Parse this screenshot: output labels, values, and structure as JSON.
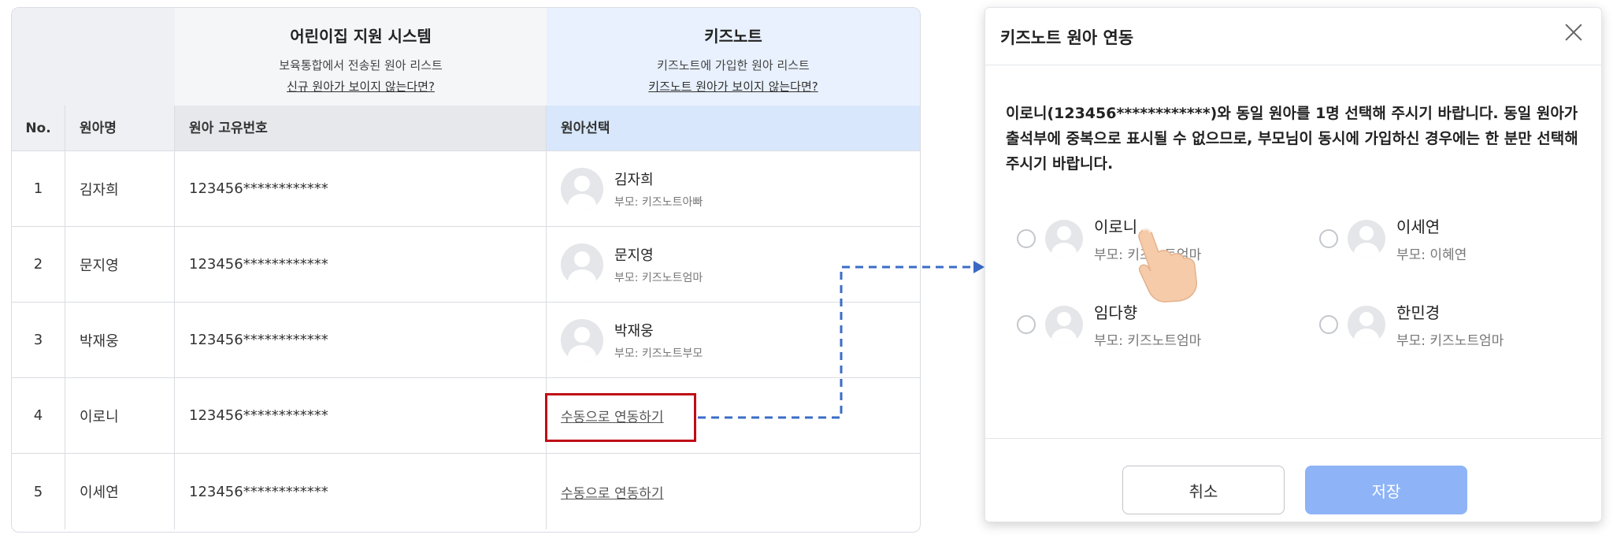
{
  "table": {
    "header_system": {
      "title": "어린이집 지원 시스템",
      "subtitle": "보육통합에서 전송된 원아 리스트",
      "link": "신규 원아가 보이지 않는다면?"
    },
    "header_kidsnote": {
      "title": "키즈노트",
      "subtitle": "키즈노트에 가입한 원아 리스트",
      "link": "키즈노트 원아가 보이지 않는다면?"
    },
    "columns": {
      "no": "No.",
      "name": "원아명",
      "id": "원아 고유번호",
      "select": "원아선택"
    },
    "rows": [
      {
        "no": "1",
        "name": "김자희",
        "id": "123456************",
        "kid_name": "김자희",
        "parent": "부모: 키즈노트아빠"
      },
      {
        "no": "2",
        "name": "문지영",
        "id": "123456************",
        "kid_name": "문지영",
        "parent": "부모: 키즈노트엄마"
      },
      {
        "no": "3",
        "name": "박재웅",
        "id": "123456************",
        "kid_name": "박재웅",
        "parent": "부모: 키즈노트부모"
      },
      {
        "no": "4",
        "name": "이로니",
        "id": "123456************",
        "link": "수동으로 연동하기"
      },
      {
        "no": "5",
        "name": "이세연",
        "id": "123456************",
        "link": "수동으로 연동하기"
      }
    ]
  },
  "modal": {
    "title": "키즈노트 원아 연동",
    "message": "이로니(123456************)와 동일 원아를 1명 선택해 주시기 바랍니다. 동일 원아가 출석부에 중복으로 표시될 수 없으므로, 부모님이 동시에 가입하신 경우에는 한 분만 선택해 주시기 바랍니다.",
    "options": [
      {
        "name": "이로니",
        "parent": "부모: 키즈노트엄마"
      },
      {
        "name": "이세연",
        "parent": "부모: 이혜연"
      },
      {
        "name": "임다향",
        "parent": "부모: 키즈노트엄마"
      },
      {
        "name": "한민경",
        "parent": "부모: 키즈노트엄마"
      }
    ],
    "cancel_label": "취소",
    "save_label": "저장"
  },
  "colors": {
    "accent_red": "#c00d16",
    "connector_blue": "#3b6cc7",
    "save_button": "#8eb4f7",
    "kidsnote_header": "#e8f1fd"
  }
}
